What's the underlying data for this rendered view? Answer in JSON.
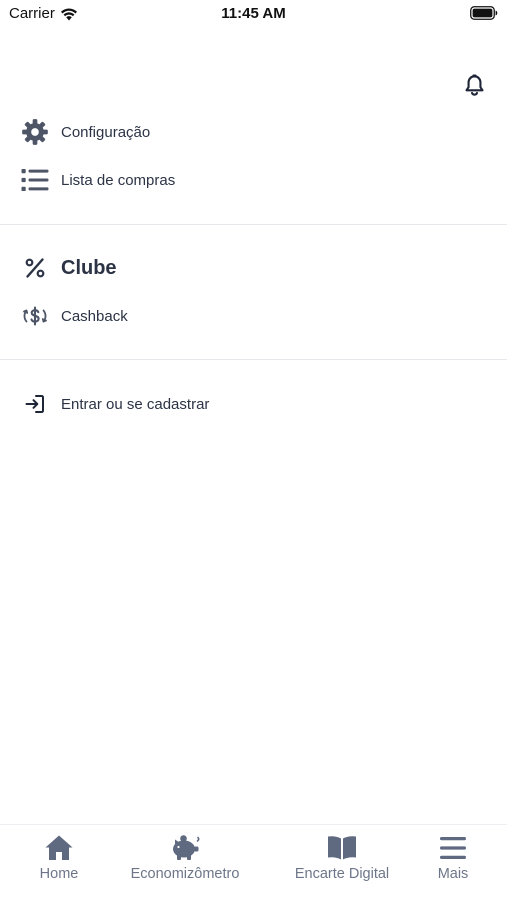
{
  "status_bar": {
    "carrier": "Carrier",
    "time": "11:45 AM"
  },
  "menu": {
    "config_label": "Configuração",
    "lista_label": "Lista de compras",
    "clube_heading": "Clube",
    "cashback_label": "Cashback",
    "entrar_label": "Entrar ou se cadastrar"
  },
  "tabs": [
    {
      "label": "Home",
      "icon": "home-icon"
    },
    {
      "label": "Economizômetro",
      "icon": "piggy-bank-icon"
    },
    {
      "label": "Encarte Digital",
      "icon": "open-book-icon"
    },
    {
      "label": "Mais",
      "icon": "hamburger-menu-icon"
    }
  ],
  "colors": {
    "icon_dark": "#2b3345",
    "icon_gray": "#4d5566",
    "tab_gray": "#6d7689",
    "divider": "#e6e8ec"
  }
}
